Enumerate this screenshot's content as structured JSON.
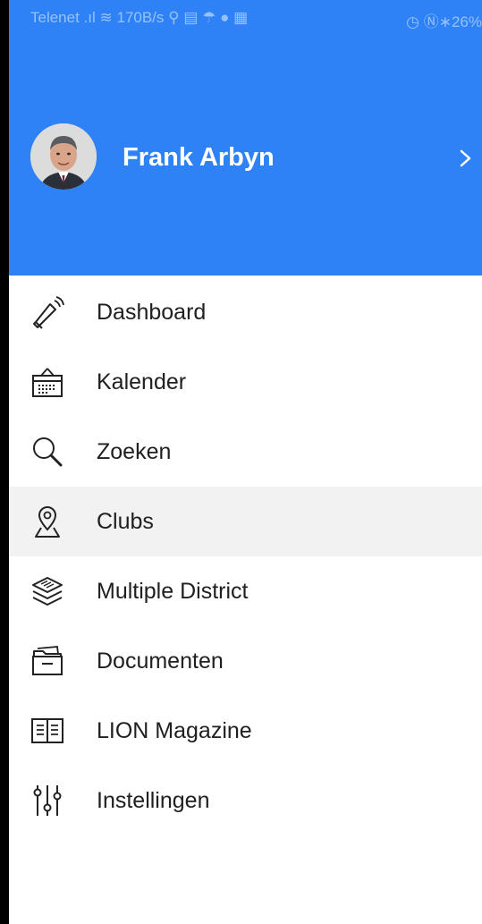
{
  "status_bar": {
    "carrier": "Telenet",
    "speed": "170B/s",
    "battery": "26%"
  },
  "profile": {
    "name": "Frank Arbyn"
  },
  "menu": {
    "items": [
      {
        "label": "Dashboard",
        "icon": "megaphone-icon"
      },
      {
        "label": "Kalender",
        "icon": "calendar-icon"
      },
      {
        "label": "Zoeken",
        "icon": "search-icon"
      },
      {
        "label": "Clubs",
        "icon": "location-pin-icon",
        "active": true
      },
      {
        "label": "Multiple District",
        "icon": "layers-icon"
      },
      {
        "label": "Documenten",
        "icon": "folder-icon"
      },
      {
        "label": "LION Magazine",
        "icon": "magazine-icon"
      },
      {
        "label": "Instellingen",
        "icon": "sliders-icon"
      }
    ]
  },
  "colors": {
    "header": "#2f82f5",
    "active_row": "#f2f2f2",
    "text": "#202020"
  }
}
